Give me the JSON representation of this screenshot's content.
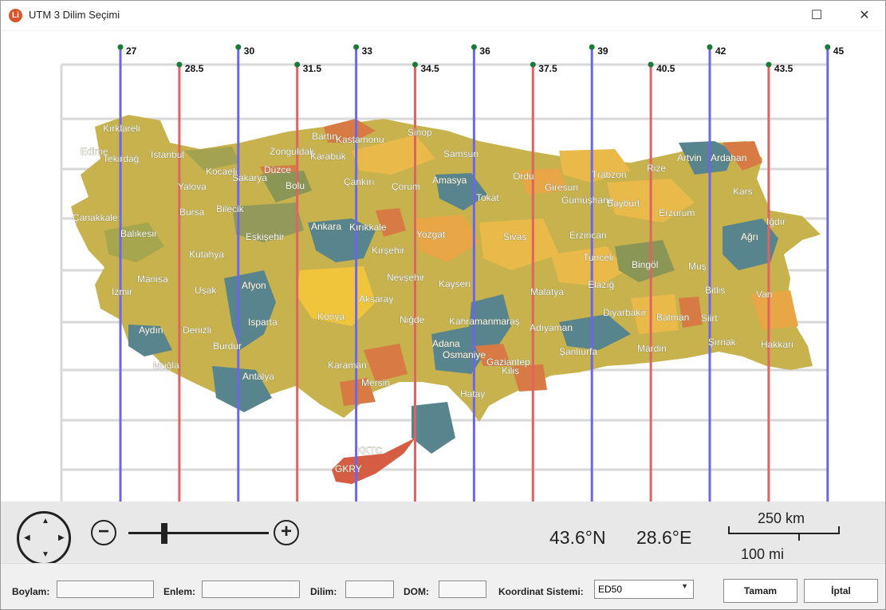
{
  "window": {
    "title": "UTM 3 Dilim Seçimi",
    "icon_text": "Li",
    "maximize_glyph": "☐",
    "close_glyph": "✕"
  },
  "map": {
    "meridians": [
      {
        "label": "27",
        "kind": "main"
      },
      {
        "label": "28.5",
        "kind": "half"
      },
      {
        "label": "30",
        "kind": "main"
      },
      {
        "label": "31.5",
        "kind": "half"
      },
      {
        "label": "33",
        "kind": "main"
      },
      {
        "label": "34.5",
        "kind": "half"
      },
      {
        "label": "36",
        "kind": "main"
      },
      {
        "label": "37.5",
        "kind": "half"
      },
      {
        "label": "39",
        "kind": "main"
      },
      {
        "label": "40.5",
        "kind": "half"
      },
      {
        "label": "42",
        "kind": "main"
      },
      {
        "label": "43.5",
        "kind": "half"
      },
      {
        "label": "45",
        "kind": "main"
      }
    ],
    "colors": {
      "main": "#6f66e3",
      "half": "#e06363",
      "dot": "#1a7a3a"
    },
    "provinces": [
      "Kırklareli",
      "Edirne",
      "Tekirdağ",
      "İstanbul",
      "Kocaeli",
      "Sakarya",
      "Düzce",
      "Zonguldak",
      "Bartın",
      "Karabük",
      "Kastamonu",
      "Sinop",
      "Samsun",
      "Ordu",
      "Trabzon",
      "Rize",
      "Artvin",
      "Ardahan",
      "Kars",
      "Iğdır",
      "Ağrı",
      "Çanakkale",
      "Yalova",
      "Bursa",
      "Bilecik",
      "Bolu",
      "Çankırı",
      "Çorum",
      "Amasya",
      "Tokat",
      "Giresun",
      "Gümüşhane",
      "Bayburt",
      "Erzurum",
      "Balıkesir",
      "Eskişehir",
      "Ankara",
      "Kırıkkale",
      "Yozgat",
      "Sivas",
      "Erzincan",
      "Kütahya",
      "Kırşehir",
      "Tunceli",
      "Bingöl",
      "Muş",
      "Manisa",
      "Nevşehir",
      "Kayseri",
      "Malatya",
      "Elazığ",
      "Bitlis",
      "Van",
      "İzmir",
      "Uşak",
      "Afyon",
      "Aksaray",
      "Konya",
      "Niğde",
      "Kahramanmaraş",
      "Adıyaman",
      "Diyarbakır",
      "Batman",
      "Siirt",
      "Aydın",
      "Denizli",
      "Isparta",
      "Burdur",
      "Adana",
      "Osmaniye",
      "Gaziantep",
      "Kilis",
      "Şanlıurfa",
      "Mardin",
      "Şırnak",
      "Hakkari",
      "Muğla",
      "Antalya",
      "Karaman",
      "Mersin",
      "Hatay",
      "KKTC",
      "GKRY"
    ]
  },
  "controls": {
    "zoom_out": "−",
    "zoom_in": "+",
    "latitude": "43.6°N",
    "longitude": "28.6°E",
    "scale_km": "250 km",
    "scale_mi": "100 mi"
  },
  "form": {
    "boylam_label": "Boylam:",
    "enlem_label": "Enlem:",
    "dilim_label": "Dilim:",
    "dom_label": "DOM:",
    "koordinat_label": "Koordinat Sistemi:",
    "koordinat_value": "ED50",
    "ok_label": "Tamam",
    "cancel_label": "İptal"
  }
}
